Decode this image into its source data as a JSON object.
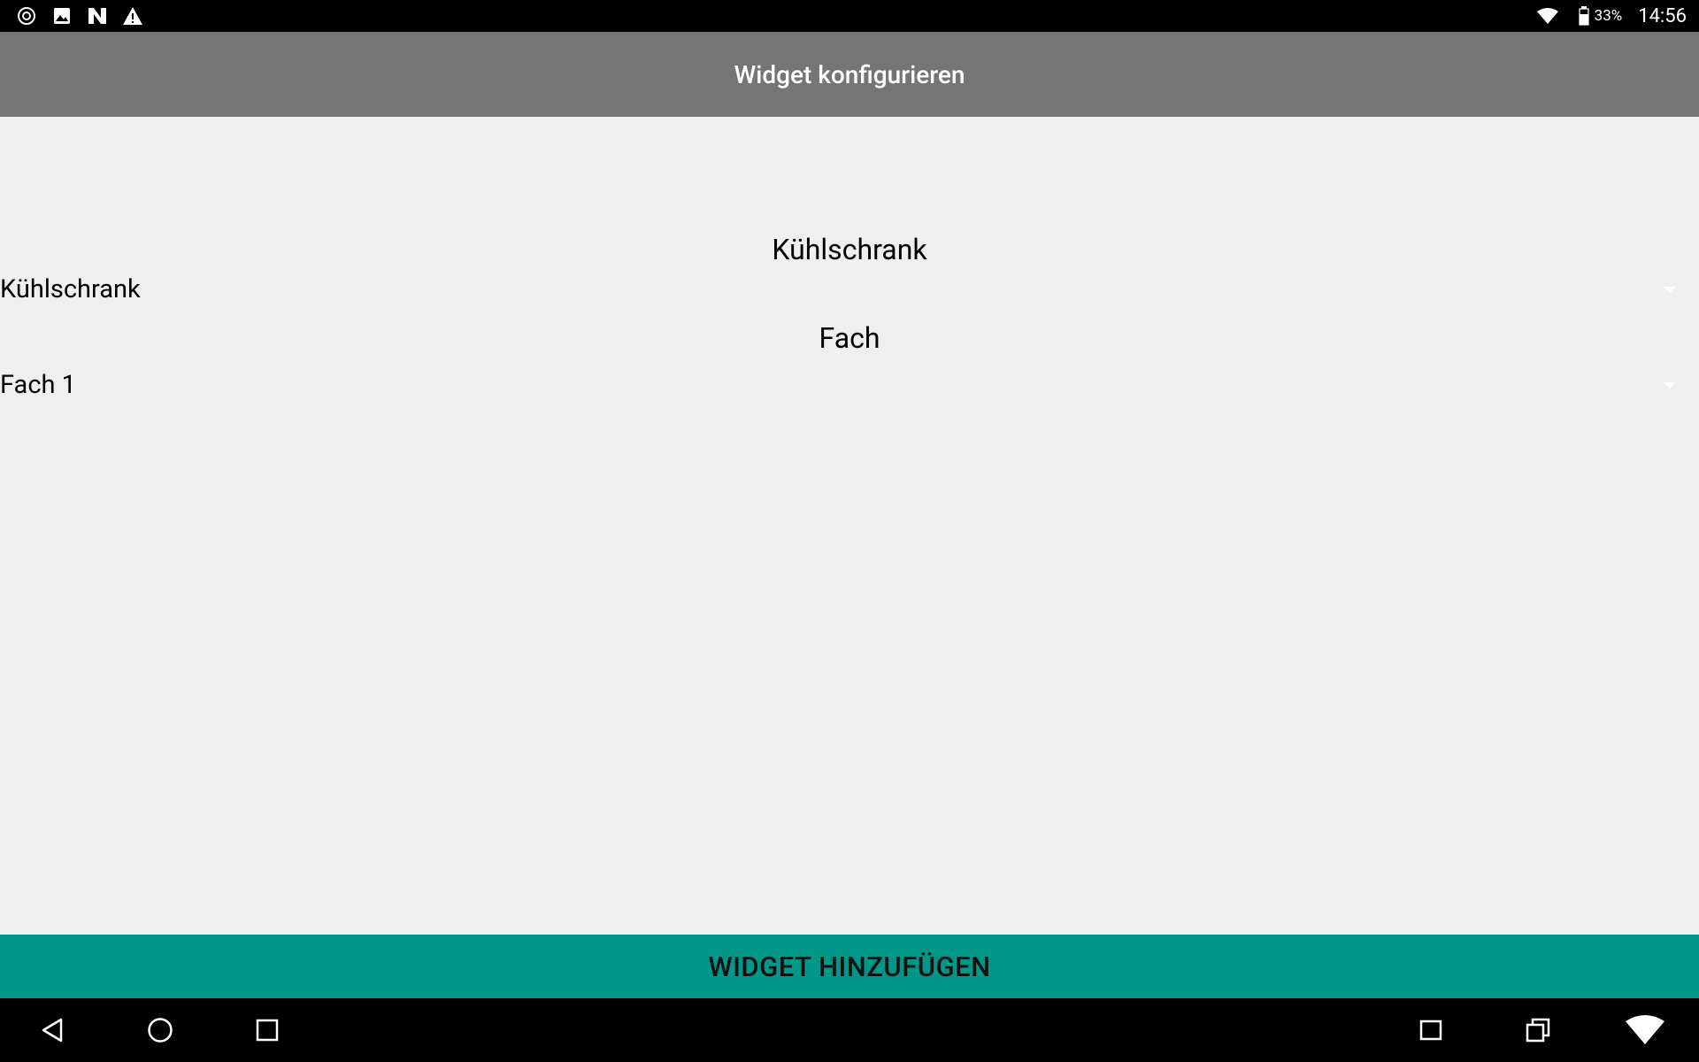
{
  "status_bar": {
    "icons_left": [
      "location-icon",
      "image-icon",
      "n-logo-icon",
      "warning-icon"
    ],
    "icons_right": [
      "wifi-icon",
      "battery-icon"
    ],
    "battery_percent": "33%",
    "time": "14:56"
  },
  "app_bar": {
    "title": "Widget konfigurieren"
  },
  "form": {
    "fridge_label": "Kühlschrank",
    "fridge_value": "Kühlschrank",
    "compartment_label": "Fach",
    "compartment_value": "Fach 1"
  },
  "actions": {
    "add_widget_label": "WIDGET HINZUFÜGEN"
  },
  "nav_bar": {
    "left": [
      "back-icon",
      "home-icon",
      "recents-icon"
    ],
    "right": [
      "window-icon",
      "multi-window-icon",
      "wifi-icon"
    ]
  },
  "colors": {
    "status_bar": "#000000",
    "app_bar": "#757575",
    "background": "#efefef",
    "accent_button": "#009688",
    "nav_bar": "#000000"
  }
}
